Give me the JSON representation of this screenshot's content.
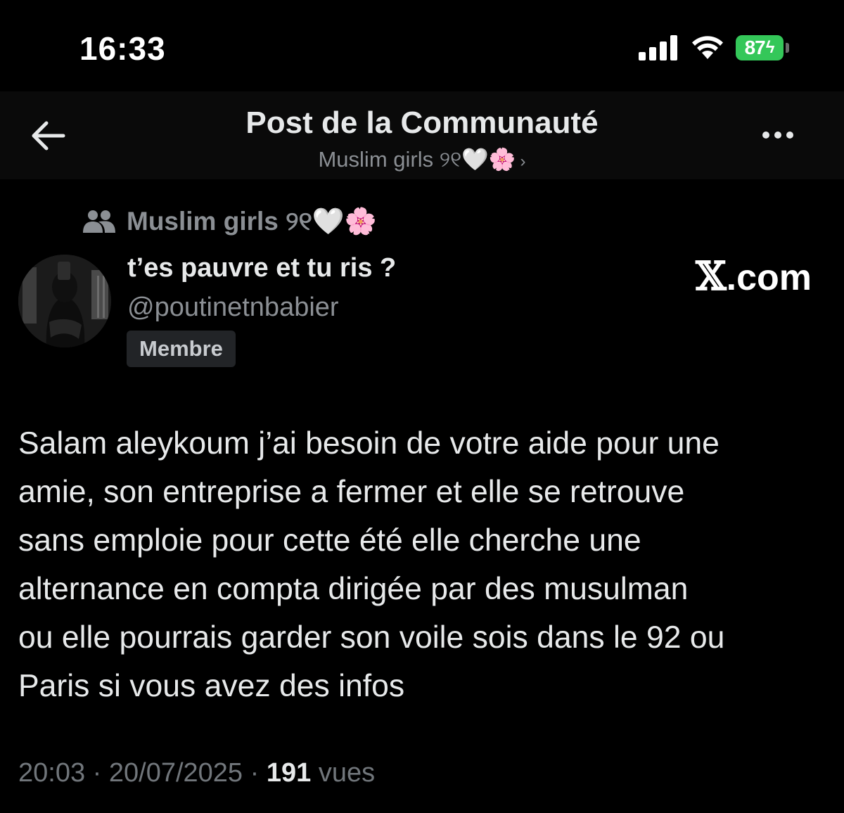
{
  "status_bar": {
    "time": "16:33",
    "battery": "87",
    "battery_color": "#34c759"
  },
  "header": {
    "title": "Post de la Communauté",
    "subtitle": "Muslim girls ୨୧🤍🌸",
    "back_icon": "arrow-left-icon",
    "more_icon": "more-horizontal-icon",
    "chevron_icon": "chevron-right-icon"
  },
  "community": {
    "icon": "people-icon",
    "name": "Muslim girls ୨୧🤍🌸"
  },
  "author": {
    "display_name": "t’es pauvre et tu ris ?",
    "handle": "@poutinetnbabier",
    "badge": "Membre"
  },
  "watermark": {
    "mark": "𝕏",
    "domain": ".com"
  },
  "post": {
    "lines": [
      "Salam aleykoum j’ai besoin de votre aide pour une",
      "amie, son entreprise a fermer et elle se retrouve",
      "sans emploie pour cette été elle cherche une",
      "alternance en compta dirigée par des musulman",
      "ou elle pourrais garder son voile sois dans le 92 ou",
      "Paris si vous avez des infos"
    ]
  },
  "meta": {
    "time": "20:03",
    "separator": " · ",
    "date": "20/07/2025",
    "views_count": "191",
    "views_label": "vues"
  },
  "colors": {
    "background": "#000000",
    "header_background": "#0a0a0a",
    "text_primary": "#e7e9ea",
    "text_secondary": "#8b8f94",
    "meta_text": "#71767b",
    "badge_background": "#222427"
  }
}
